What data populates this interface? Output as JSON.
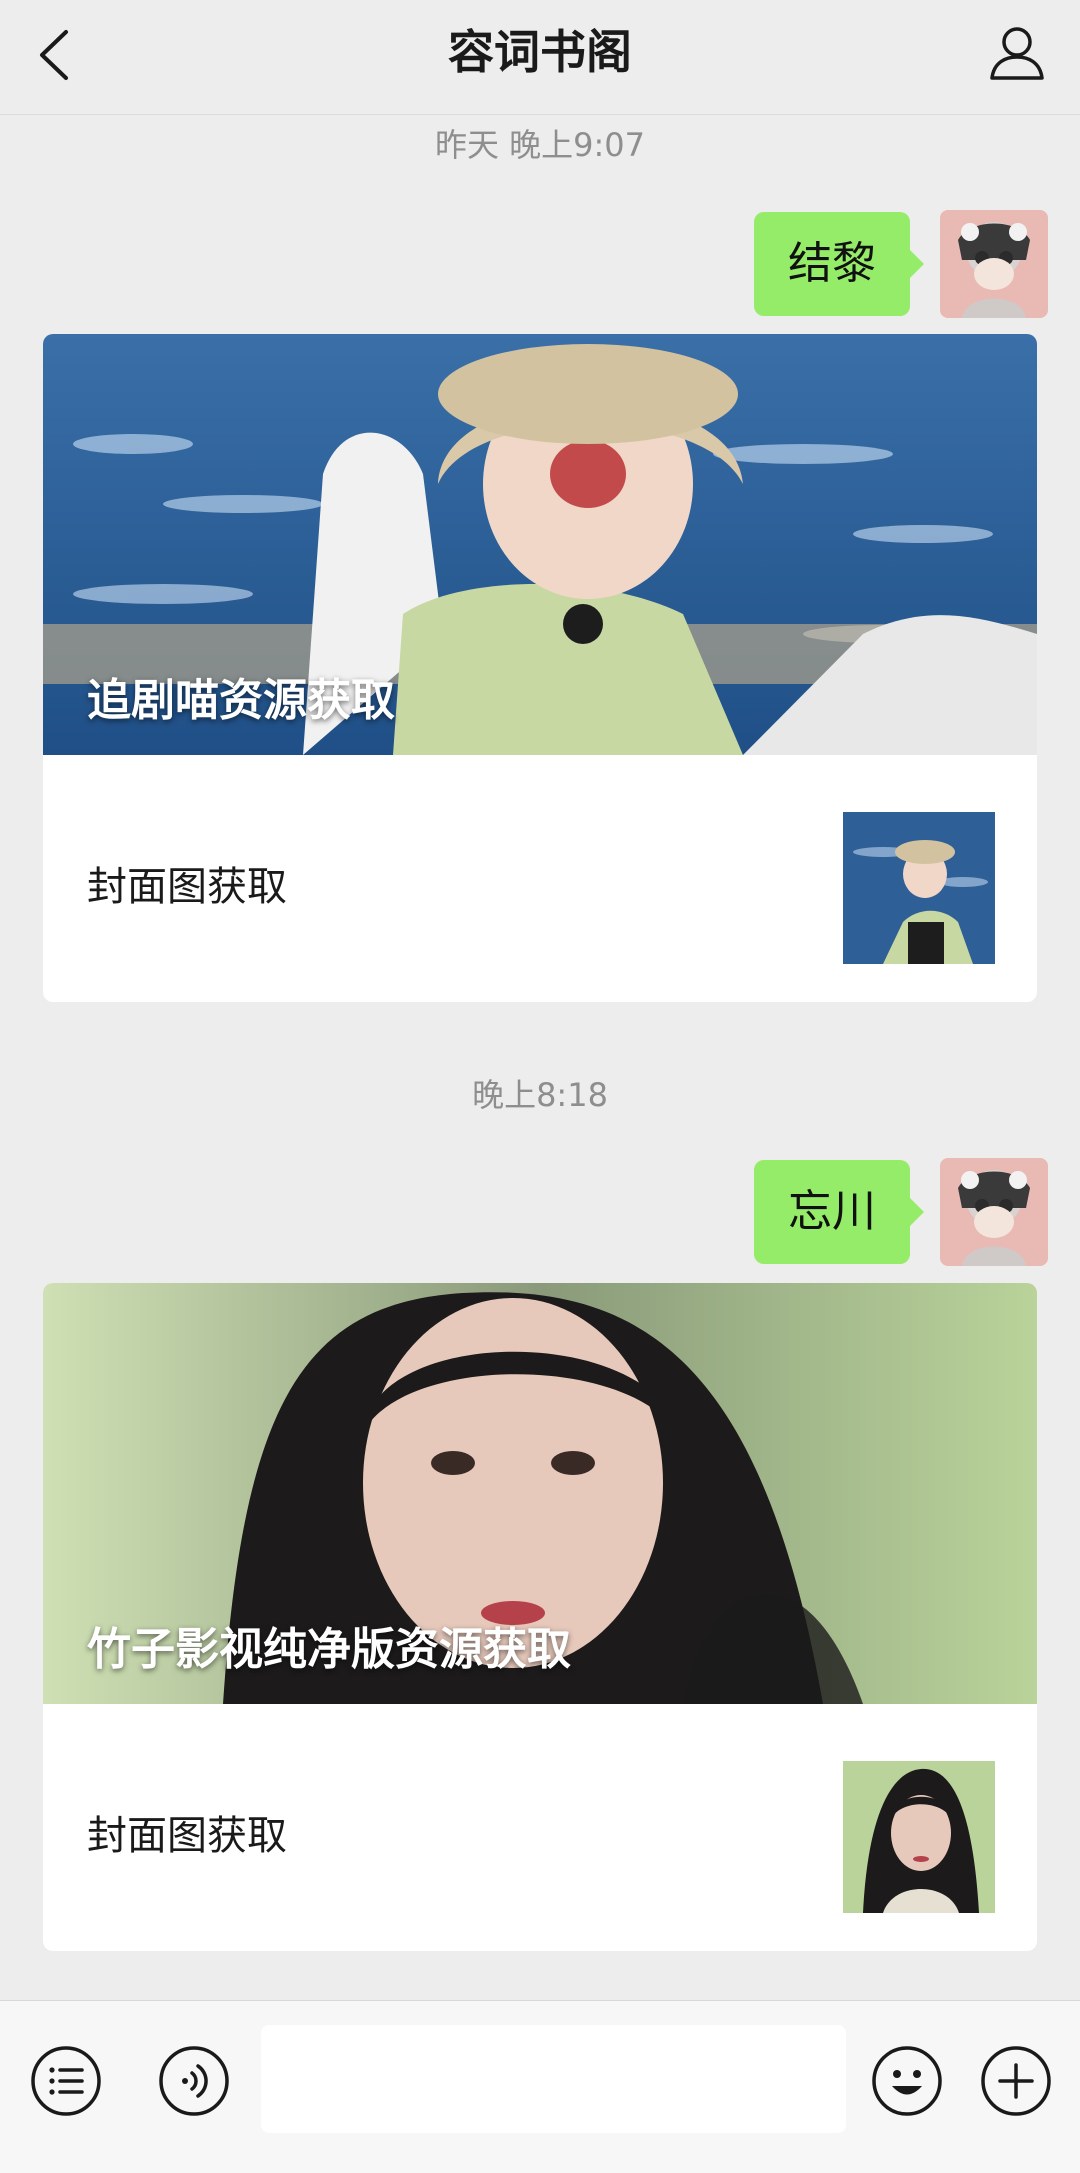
{
  "header": {
    "title": "容词书阁",
    "back_icon": "chevron-left-icon",
    "profile_icon": "person-icon"
  },
  "messages": [
    {
      "timestamp": "昨天 晚上9:07",
      "bubble_text": "结黎",
      "card": {
        "cover_title": "追剧喵资源获取",
        "subtitle": "封面图获取"
      }
    },
    {
      "timestamp": "晚上8:18",
      "bubble_text": "忘川",
      "card": {
        "cover_title": "竹子影视纯净版资源获取",
        "subtitle": "封面图获取"
      }
    }
  ],
  "input_bar": {
    "menu_icon": "list-menu-icon",
    "voice_icon": "voice-icon",
    "emoji_icon": "emoji-icon",
    "plus_icon": "plus-icon",
    "input_value": ""
  },
  "colors": {
    "background": "#ededed",
    "bubble": "#95ec69",
    "card": "#ffffff",
    "timestamp": "#8e8e8e"
  }
}
